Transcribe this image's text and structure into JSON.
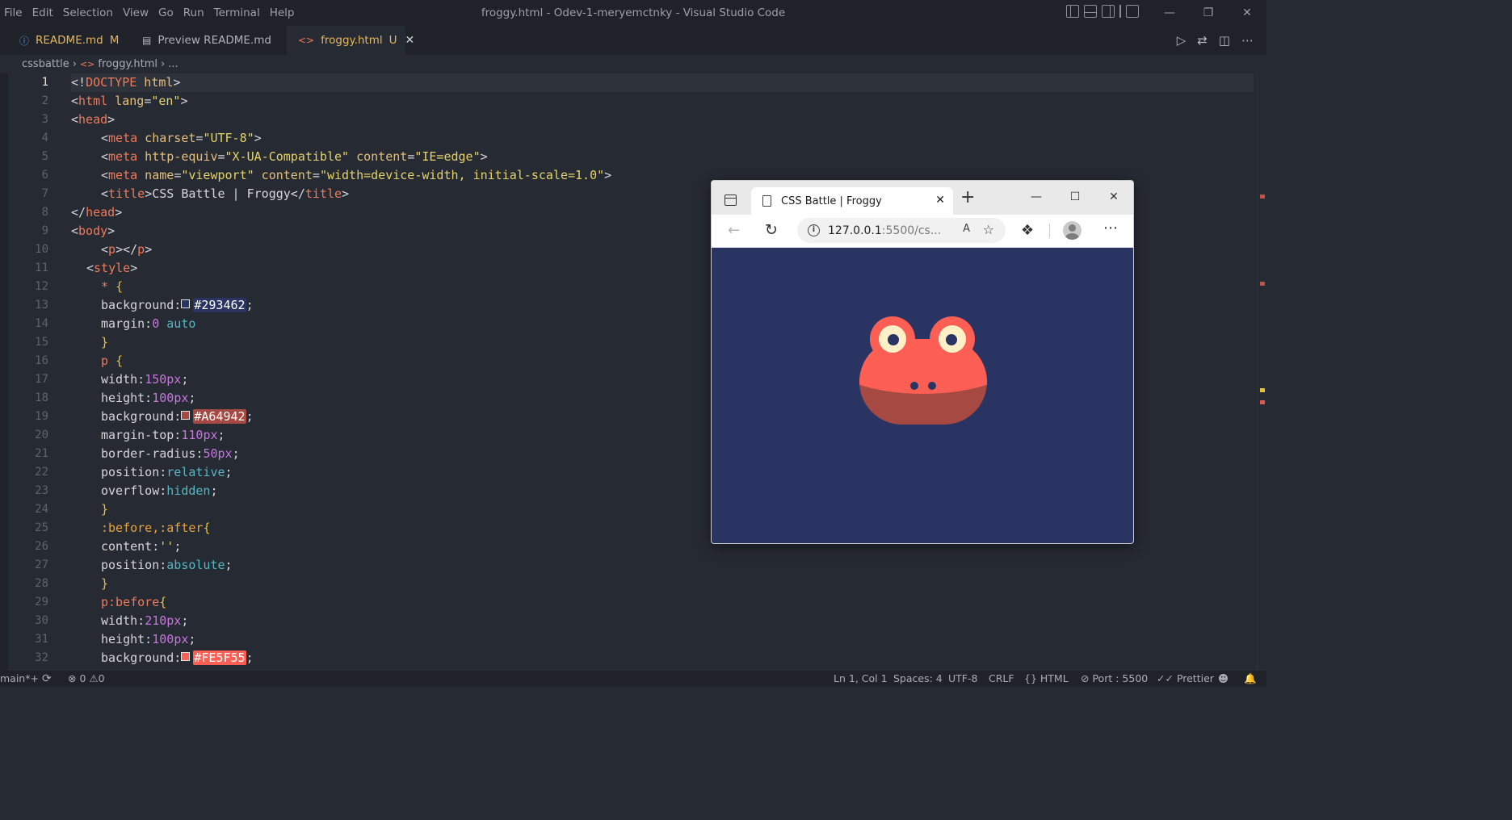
{
  "titlebar": {
    "menu": [
      "File",
      "Edit",
      "Selection",
      "View",
      "Go",
      "Run",
      "Terminal",
      "Help"
    ],
    "window_title": "froggy.html - Odev-1-meryemctnky - Visual Studio Code",
    "controls": [
      "minimize",
      "restore",
      "close"
    ]
  },
  "tabs": [
    {
      "label": "README.md",
      "badge": "M",
      "icon": "info-icon",
      "active": false
    },
    {
      "label": "Preview README.md",
      "badge": "",
      "icon": "preview-icon",
      "active": false
    },
    {
      "label": "froggy.html",
      "badge": "U",
      "icon": "html-file-icon",
      "active": true
    }
  ],
  "breadcrumb": {
    "folder": "cssbattle",
    "file": "froggy.html",
    "more": "..."
  },
  "editor": {
    "current_line": "1",
    "line_numbers": [
      "1",
      "2",
      "3",
      "4",
      "5",
      "6",
      "7",
      "8",
      "9",
      "10",
      "11",
      "12",
      "13",
      "14",
      "15",
      "16",
      "17",
      "18",
      "19",
      "20",
      "21",
      "22",
      "23",
      "24",
      "25",
      "26",
      "27",
      "28",
      "29",
      "30",
      "31",
      "32"
    ],
    "code": {
      "l1": {
        "a": "<!",
        "b": "DOCTYPE",
        "c": " html",
        "d": ">"
      },
      "l2": {
        "a": "<",
        "b": "html",
        "c": " lang",
        "d": "=",
        "e": "\"en\"",
        "f": ">"
      },
      "l3": {
        "a": "<",
        "b": "head",
        "c": ">"
      },
      "l4": {
        "a": "<",
        "b": "meta",
        "c": " charset",
        "d": "=",
        "e": "\"UTF-8\"",
        "f": ">"
      },
      "l5": {
        "a": "<",
        "b": "meta",
        "c": " http-equiv",
        "d": "=",
        "e": "\"X-UA-Compatible\"",
        "f": " content",
        "g": "=",
        "h": "\"IE=edge\"",
        "i": ">"
      },
      "l6": {
        "a": "<",
        "b": "meta",
        "c": " name",
        "d": "=",
        "e": "\"viewport\"",
        "f": " content",
        "g": "=",
        "h": "\"width=device-width, initial-scale=1.0\"",
        "i": ">"
      },
      "l7": {
        "a": "<",
        "b": "title",
        "c": ">CSS Battle | Froggy</",
        "d": "title",
        "e": ">"
      },
      "l8": {
        "a": "</",
        "b": "head",
        "c": ">"
      },
      "l9": {
        "a": "<",
        "b": "body",
        "c": ">"
      },
      "l10": {
        "a": "<",
        "b": "p",
        "c": "></",
        "d": "p",
        "e": ">"
      },
      "l11": {
        "a": "<",
        "b": "style",
        "c": ">"
      },
      "l12": {
        "a": "* ",
        "b": "{"
      },
      "l13": {
        "a": "background:",
        "hex": "#293462",
        "b": ";"
      },
      "l14": {
        "a": "margin:",
        "b": "0",
        "c": " auto"
      },
      "l15": {
        "a": "}"
      },
      "l16": {
        "a": "p ",
        "b": "{"
      },
      "l17": {
        "a": "width:",
        "b": "150",
        "c": "px",
        "d": ";"
      },
      "l18": {
        "a": "height:",
        "b": "100",
        "c": "px",
        "d": ";"
      },
      "l19": {
        "a": "background:",
        "hex": "#A64942",
        "b": ";"
      },
      "l20": {
        "a": "margin-top:",
        "b": "110",
        "c": "px",
        "d": ";"
      },
      "l21": {
        "a": "border-radius:",
        "b": "50",
        "c": "px",
        "d": ";"
      },
      "l22": {
        "a": "position:",
        "b": "relative",
        "c": ";"
      },
      "l23": {
        "a": "overflow:",
        "b": "hidden",
        "c": ";"
      },
      "l24": {
        "a": "}"
      },
      "l25": {
        "a": ":before,:after",
        "b": "{"
      },
      "l26": {
        "a": "content:",
        "b": "''",
        "c": ";"
      },
      "l27": {
        "a": "position:",
        "b": "absolute",
        "c": ";"
      },
      "l28": {
        "a": "}"
      },
      "l29": {
        "a": "p:before",
        "b": "{"
      },
      "l30": {
        "a": "width:",
        "b": "210",
        "c": "px",
        "d": ";"
      },
      "l31": {
        "a": "height:",
        "b": "100",
        "c": "px",
        "d": ";"
      },
      "l32": {
        "a": "background:",
        "hex": "#FE5F55",
        "b": ";"
      }
    },
    "swatch_colors": {
      "c1": "#293462",
      "c2": "#A64942",
      "c3": "#FE5F55"
    }
  },
  "browser": {
    "tab_title": "CSS Battle | Froggy",
    "url_main": "127.0.0.1",
    "url_rest": ":5500/cs...",
    "read_aloud": "A",
    "colors": {
      "bg": "#293462",
      "body": "#FE5F55",
      "mouth": "#A64942",
      "eye_white": "#FFF0C8",
      "pupil": "#293462"
    }
  },
  "statusbar": {
    "branch": "main*+",
    "errors": "0",
    "warnings": "0",
    "position": "Ln 1, Col 1",
    "spaces": "Spaces: 4",
    "encoding": "UTF-8",
    "eol": "CRLF",
    "language": "HTML",
    "port": "Port : 5500",
    "prettier": "Prettier"
  },
  "icons": [
    "info-icon",
    "preview-icon",
    "html-file-icon",
    "close-icon",
    "run-icon",
    "compare-icon",
    "split-editor-icon",
    "more-icon",
    "chevron-right-icon",
    "sync-icon",
    "error-icon",
    "warning-icon",
    "braces-icon",
    "broadcast-icon",
    "check-icon",
    "feedback-icon",
    "bell-icon",
    "back-arrow-icon",
    "reload-icon",
    "extensions-icon",
    "profile-icon",
    "star-add-icon"
  ]
}
